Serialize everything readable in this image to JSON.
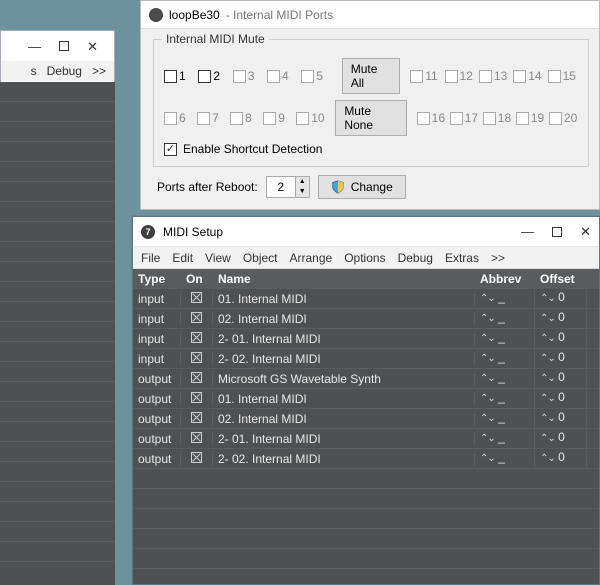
{
  "bg": {
    "menu_debug": "Debug",
    "menu_more": ">>"
  },
  "loopbe": {
    "title_app": "loopBe30",
    "title_sub": "- Internal MIDI Ports",
    "group_legend": "Internal MIDI Mute",
    "row1": [
      "1",
      "2",
      "3",
      "4",
      "5"
    ],
    "row2": [
      "6",
      "7",
      "8",
      "9",
      "10"
    ],
    "row1b": [
      "11",
      "12",
      "13",
      "14",
      "15"
    ],
    "row2b": [
      "16",
      "17",
      "18",
      "19",
      "20"
    ],
    "mute_all": "Mute All",
    "mute_none": "Mute None",
    "enable_label": "Enable Shortcut Detection",
    "ports_label": "Ports after Reboot:",
    "ports_value": "2",
    "change_label": "Change"
  },
  "midi": {
    "title": "MIDI Setup",
    "menu": [
      "File",
      "Edit",
      "View",
      "Object",
      "Arrange",
      "Options",
      "Debug",
      "Extras",
      ">>"
    ],
    "columns": [
      "Type",
      "On",
      "Name",
      "Abbrev",
      "Offset"
    ],
    "stepper_glyph": "⌃⌄",
    "abbrev_value": "_",
    "offset_value": "0",
    "rows": [
      {
        "type": "input",
        "name": "01. Internal MIDI"
      },
      {
        "type": "input",
        "name": "02. Internal MIDI"
      },
      {
        "type": "input",
        "name": "2- 01. Internal MIDI"
      },
      {
        "type": "input",
        "name": "2- 02. Internal MIDI"
      },
      {
        "type": "output",
        "name": "Microsoft GS Wavetable Synth"
      },
      {
        "type": "output",
        "name": "01. Internal MIDI"
      },
      {
        "type": "output",
        "name": "02. Internal MIDI"
      },
      {
        "type": "output",
        "name": "2- 01. Internal MIDI"
      },
      {
        "type": "output",
        "name": "2- 02. Internal MIDI"
      }
    ]
  }
}
